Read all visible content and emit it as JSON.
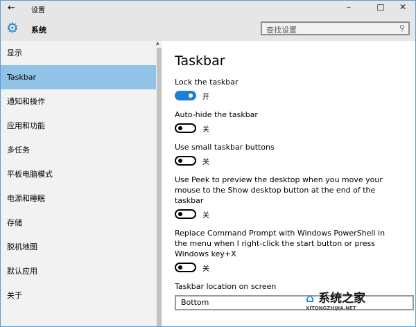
{
  "window": {
    "title": "设置",
    "minimize": "–",
    "maximize": "□",
    "close": "✕",
    "back": "←"
  },
  "header": {
    "title": "系统",
    "search_placeholder": "查找设置"
  },
  "sidebar": {
    "items": [
      {
        "label": "显示"
      },
      {
        "label": "Taskbar",
        "selected": true
      },
      {
        "label": "通知和操作"
      },
      {
        "label": "应用和功能"
      },
      {
        "label": "多任务"
      },
      {
        "label": "平板电脑模式"
      },
      {
        "label": "电源和睡眠"
      },
      {
        "label": "存储"
      },
      {
        "label": "脱机地图"
      },
      {
        "label": "默认应用"
      },
      {
        "label": "关于"
      }
    ]
  },
  "main": {
    "title": "Taskbar",
    "settings": [
      {
        "label": "Lock the taskbar",
        "state": "开",
        "on": true
      },
      {
        "label": "Auto-hide the taskbar",
        "state": "关",
        "on": false
      },
      {
        "label": "Use small taskbar buttons",
        "state": "关",
        "on": false
      },
      {
        "label": "Use Peek to preview the desktop when you move your mouse to the Show desktop button at the end of the taskbar",
        "state": "关",
        "on": false
      },
      {
        "label": "Replace Command Prompt with Windows PowerShell in the menu when I right-click the start button or press Windows key+X",
        "state": "关",
        "on": false
      }
    ],
    "location_label": "Taskbar location on screen",
    "location_value": "Bottom"
  },
  "watermark": {
    "text": "系统之家",
    "sub": "XITONGZHIJIA.NET"
  },
  "colors": {
    "accent": "#1e7fd6",
    "selected": "#91c3e9"
  }
}
